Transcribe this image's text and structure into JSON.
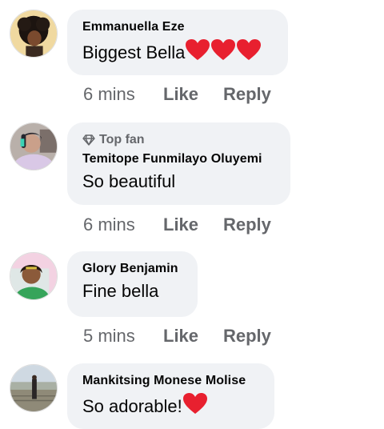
{
  "comments": [
    {
      "author": "Emmanuella Eze",
      "text": "Biggest Bella",
      "emojis": [
        "red-heart",
        "red-heart",
        "red-heart"
      ],
      "time": "6 mins",
      "like_label": "Like",
      "reply_label": "Reply"
    },
    {
      "badge": "Top fan",
      "author": "Temitope Funmilayo Oluyemi",
      "text": "So beautiful",
      "time": "6 mins",
      "like_label": "Like",
      "reply_label": "Reply"
    },
    {
      "author": "Glory Benjamin",
      "text": "Fine bella",
      "time": "5 mins",
      "like_label": "Like",
      "reply_label": "Reply"
    },
    {
      "author": "Mankitsing Monese Molise",
      "text": "So adorable!",
      "emojis": [
        "red-heart"
      ]
    }
  ],
  "colors": {
    "bubble": "#f0f2f5",
    "text": "#050505",
    "secondary": "#65676b",
    "heart": "#e8202f"
  }
}
